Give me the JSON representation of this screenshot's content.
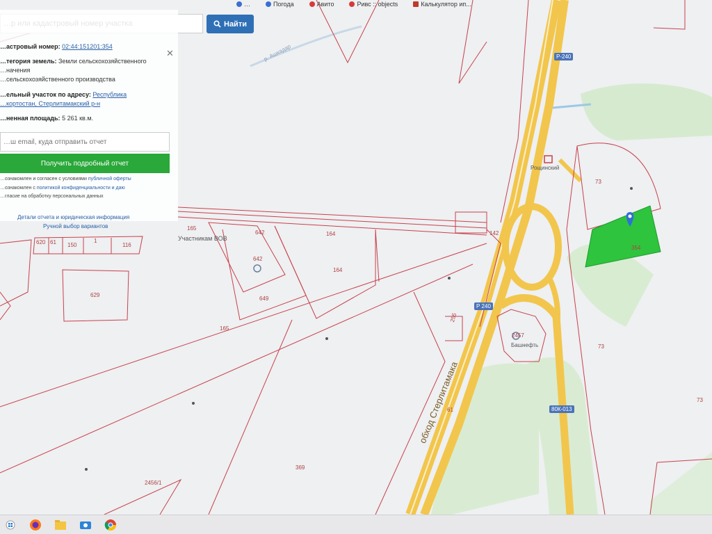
{
  "browser": {
    "bookmarks": [
      {
        "label": "…",
        "icon": "bookmark-icon",
        "color": "#3b6fd0"
      },
      {
        "label": "Погода",
        "icon": "weather-icon",
        "color": "#3b6fd0"
      },
      {
        "label": "Авито",
        "icon": "avito-icon",
        "color": "#d83a3a"
      },
      {
        "label": "Ривс :: objects",
        "icon": "bookmark-icon",
        "color": "#d83a3a"
      },
      {
        "label": "Калькулятор ип...",
        "icon": "calculator-icon",
        "color": "#c0392b"
      }
    ]
  },
  "search": {
    "placeholder": "…р или кадастровый номер участка",
    "button_label": "Найти"
  },
  "info": {
    "cadastral_label": "…астровый номер:",
    "cadastral_value": "02:44:151201:354",
    "category_label": "…тегория земель:",
    "category_value_1": "Земли сельскохозяйственного",
    "category_value_2": "…начения",
    "category_value_3": "…сельскохозяйственного производства",
    "address_label": "…ельный участок по адресу:",
    "address_link_1": "Республика",
    "address_link_2": "…кортостан, Стерлитамакский р-н",
    "area_label": "…ненная площадь:",
    "area_value": "5 261 кв.м."
  },
  "report": {
    "email_placeholder": "…ш email, куда отправить отчет",
    "button_label": "Получить подробный отчет",
    "consent_1": "…ознакомлен и согласен с условиями ",
    "consent_1_link": "публичной оферты",
    "consent_2": "…ознакомлен с ",
    "consent_2_link": "политикой конфиденциальности и даю",
    "consent_3": "…гласие на обработку персональных данных",
    "link_details": "Детали отчета и юридическая информация",
    "link_manual": "Ручной выбор вариантов"
  },
  "map": {
    "parcel_labels": [
      {
        "text": "642"
      },
      {
        "text": "164"
      },
      {
        "text": "642"
      },
      {
        "text": "164"
      },
      {
        "text": "649"
      },
      {
        "text": "165"
      },
      {
        "text": "629"
      },
      {
        "text": "620"
      },
      {
        "text": "61"
      },
      {
        "text": "150"
      },
      {
        "text": "1"
      },
      {
        "text": "116"
      },
      {
        "text": "165"
      },
      {
        "text": "142"
      },
      {
        "text": "73"
      },
      {
        "text": "73"
      },
      {
        "text": "73"
      },
      {
        "text": "354"
      },
      {
        "text": "369"
      },
      {
        "text": "2456/1"
      },
      {
        "text": "255"
      },
      {
        "text": "2457"
      },
      {
        "text": "61"
      }
    ],
    "poi_labels": {
      "monument": "Участникам ВОВ",
      "river": "р. Ашкадар",
      "place_1": "Рощинский",
      "place_2": "Башнефть"
    },
    "road_labels": {
      "bypass": "обход Стерлитамака",
      "r240_a": "Р-240",
      "r240_b": "Р 240",
      "r240_c": "Р 240",
      "local": "80К-013"
    },
    "colors": {
      "parcel_border": "#c9404a",
      "selected_parcel": "#2ec43e",
      "forest": "#d8ecd0",
      "road": "#f2c64c"
    }
  },
  "taskbar": {
    "icons": [
      "windows-start-icon",
      "firefox-icon",
      "file-explorer-icon",
      "camera-icon",
      "chrome-icon"
    ]
  }
}
